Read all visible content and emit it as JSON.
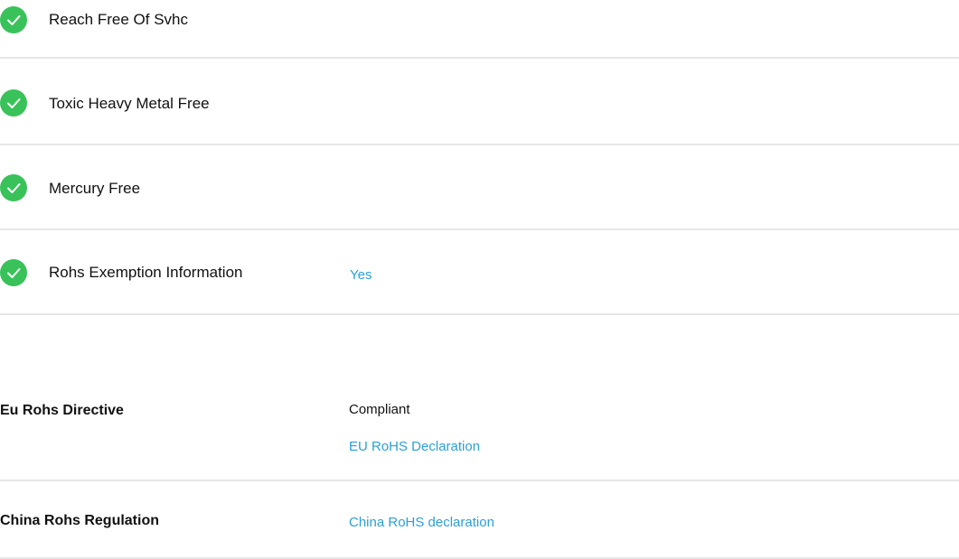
{
  "checklist": [
    {
      "label": "Reach Free Of Svhc",
      "icon": "check-circle-icon",
      "value": ""
    },
    {
      "label": "Toxic Heavy Metal Free",
      "icon": "check-circle-icon",
      "value": ""
    },
    {
      "label": "Mercury Free",
      "icon": "check-circle-icon",
      "value": ""
    },
    {
      "label": "Rohs Exemption Information",
      "icon": "check-circle-icon",
      "value": "Yes"
    }
  ],
  "regulations": [
    {
      "label": "Eu Rohs Directive",
      "status": "Compliant",
      "link": "EU RoHS Declaration"
    },
    {
      "label": "China Rohs Regulation",
      "status": "",
      "link": "China RoHS declaration"
    }
  ],
  "colors": {
    "check_green": "#3ac25a",
    "link_blue": "#2aa0d8",
    "divider": "#e6e6e6"
  }
}
